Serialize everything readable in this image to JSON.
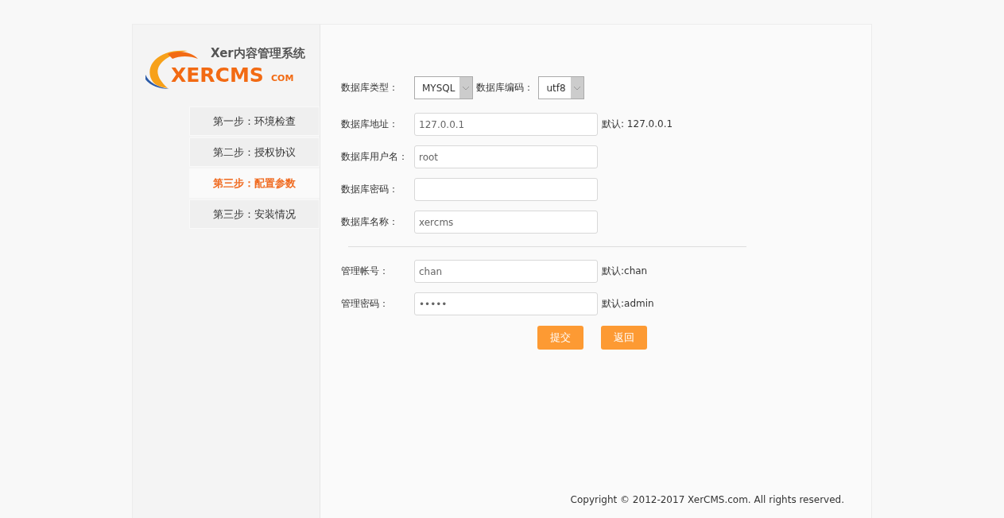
{
  "logo": {
    "tagline": "Xer内容管理系统",
    "wordmark": "XERCMS",
    "domain": "COM"
  },
  "steps": [
    {
      "label": "第一步：环境检查",
      "selected": false
    },
    {
      "label": "第二步：授权协议",
      "selected": false
    },
    {
      "label": "第三步：配置参数",
      "selected": true
    },
    {
      "label": "第三步：安装情况",
      "selected": false
    }
  ],
  "selects": [
    {
      "label": "数据库类型：",
      "value": "MYSQL"
    },
    {
      "label": "数据库编码：",
      "value": "utf8"
    }
  ],
  "database_fields": [
    {
      "label": "数据库地址：",
      "value": "127.0.0.1",
      "hint": "默认: 127.0.0.1"
    },
    {
      "label": "数据库用户名：",
      "value": "root"
    },
    {
      "label": "数据库密码："
    },
    {
      "label": "数据库名称：",
      "value": "xercms"
    }
  ],
  "admin_fields": [
    {
      "label": "管理帐号：",
      "value": "chan",
      "hint": "默认:chan"
    },
    {
      "label": "管理密码：",
      "value": "•••••",
      "hint": "默认:admin"
    }
  ],
  "buttons": [
    "提交",
    "返回"
  ],
  "footer": "Copyright © 2012-2017 XerCMS.com. All rights reserved."
}
